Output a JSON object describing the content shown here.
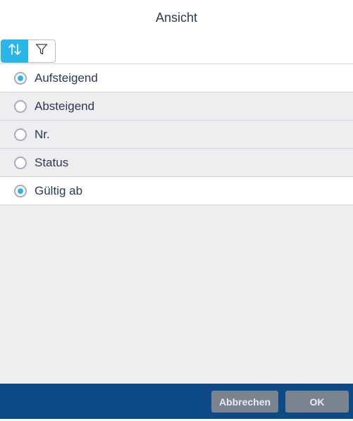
{
  "dialog": {
    "title": "Ansicht"
  },
  "toolbar": {
    "sort_icon": "sort-arrows-icon",
    "filter_icon": "filter-funnel-icon",
    "accent_color": "#29b6e8"
  },
  "options": [
    {
      "label": "Aufsteigend",
      "selected": true
    },
    {
      "label": "Absteigend",
      "selected": false
    },
    {
      "label": "Nr.",
      "selected": false
    },
    {
      "label": "Status",
      "selected": false
    },
    {
      "label": "Gültig ab",
      "selected": true
    }
  ],
  "footer": {
    "cancel_label": "Abbrechen",
    "ok_label": "OK",
    "bar_color": "#0e4a86"
  }
}
